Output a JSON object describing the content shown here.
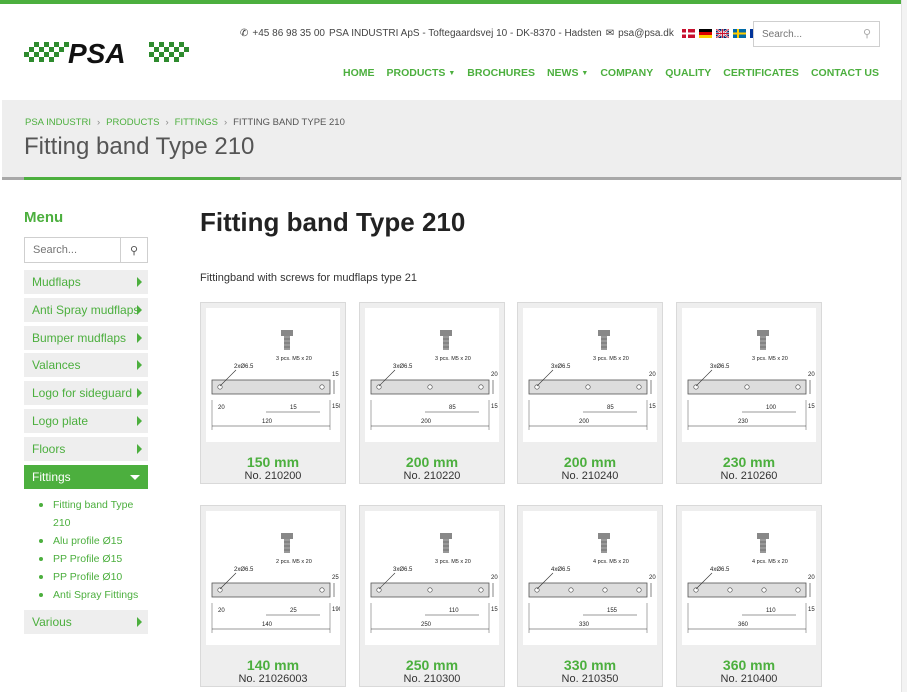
{
  "header": {
    "phone": "+45 86 98 35 00",
    "address": "PSA INDUSTRI ApS - Toftegaardsvej 10 - DK-8370 - Hadsten",
    "email": "psa@psa.dk",
    "search_placeholder": "Search...",
    "logo_text": "PSA",
    "nav": [
      "HOME",
      "PRODUCTS",
      "BROCHURES",
      "NEWS",
      "COMPANY",
      "QUALITY",
      "CERTIFICATES",
      "CONTACT US"
    ]
  },
  "breadcrumb": [
    "PSA INDUSTRI",
    "PRODUCTS",
    "FITTINGS",
    "FITTING BAND TYPE 210"
  ],
  "banner_title": "Fitting band Type 210",
  "sidebar": {
    "title": "Menu",
    "search_placeholder": "Search...",
    "items": [
      "Mudflaps",
      "Anti Spray mudflaps",
      "Bumper mudflaps",
      "Valances",
      "Logo for sideguard",
      "Logo plate",
      "Floors",
      "Fittings",
      "Various"
    ],
    "active_item": "Fittings",
    "sub_items": [
      "Fitting band Type 210",
      "Alu profile Ø15",
      "PP Profile Ø15",
      "PP Profile Ø10",
      "Anti Spray Fittings"
    ]
  },
  "main": {
    "title": "Fitting band Type 210",
    "description": "Fittingband with screws for mudflaps type 21",
    "products": [
      {
        "size": "150 mm",
        "number": "No. 210200",
        "drawing": {
          "holes": "2xØ6.5",
          "screws": "3 pcs. M5 x 20",
          "dims": [
            "15",
            "120",
            "15",
            "150",
            "20"
          ]
        }
      },
      {
        "size": "200 mm",
        "number": "No. 210220",
        "drawing": {
          "holes": "3xØ6.5",
          "screws": "3 pcs. M5 x 20",
          "dims": [
            "85",
            "200",
            "20",
            "15"
          ]
        }
      },
      {
        "size": "200 mm",
        "number": "No. 210240",
        "drawing": {
          "holes": "3xØ6.5",
          "screws": "3 pcs. M5 x 20",
          "dims": [
            "85",
            "200",
            "20",
            "15"
          ]
        }
      },
      {
        "size": "230 mm",
        "number": "No. 210260",
        "drawing": {
          "holes": "3xØ6.5",
          "screws": "3 pcs. M5 x 20",
          "dims": [
            "100",
            "230",
            "20",
            "15"
          ]
        }
      },
      {
        "size": "140 mm",
        "number": "No. 21026003",
        "drawing": {
          "holes": "2xØ6.5",
          "screws": "2 pcs. M5 x 20",
          "dims": [
            "25",
            "140",
            "25",
            "190",
            "20"
          ]
        }
      },
      {
        "size": "250 mm",
        "number": "No. 210300",
        "drawing": {
          "holes": "3xØ6.5",
          "screws": "3 pcs. M5 x 20",
          "dims": [
            "110",
            "250",
            "20",
            "15"
          ]
        }
      },
      {
        "size": "330 mm",
        "number": "No. 210350",
        "drawing": {
          "holes": "4xØ6.5",
          "screws": "4 pcs. M5 x 20",
          "dims": [
            "155",
            "330",
            "20"
          ]
        }
      },
      {
        "size": "360 mm",
        "number": "No. 210400",
        "drawing": {
          "holes": "4xØ6.5",
          "screws": "4 pcs. M5 x 20",
          "dims": [
            "110",
            "360",
            "20",
            "15"
          ]
        }
      }
    ]
  },
  "colors": {
    "accent": "#4caf3e",
    "banner": "#eeeeee"
  },
  "icons": {
    "phone": "phone-icon",
    "email": "envelope-icon",
    "search": "search-icon"
  }
}
